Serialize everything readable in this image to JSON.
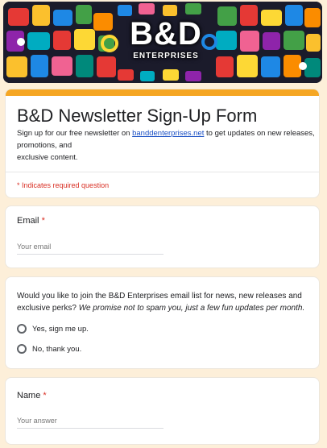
{
  "banner": {
    "brand_main": "B&D",
    "brand_sub": "ENTERPRISES"
  },
  "form": {
    "title": "B&D Newsletter Sign-Up Form",
    "description_before_link": "Sign up for our free newsletter on ",
    "description_link": "banddenterprises.net",
    "description_after_link": " to get updates on new releases, promotions, and",
    "description_line2": "exclusive content.",
    "required_note": "* Indicates required question",
    "accent_color": "#f5a623",
    "required_color": "#d93025",
    "link_color": "#1a4fc4"
  },
  "questions": {
    "email": {
      "label": "Email",
      "required_mark": "*",
      "placeholder": "Your email"
    },
    "optin": {
      "text_plain": "Would you like to join the B&D Enterprises email list for news, new releases and exclusive perks? ",
      "text_italic": "We promise not to spam you, just a few fun updates per month.",
      "options": [
        "Yes, sign me up.",
        "No, thank you."
      ]
    },
    "name": {
      "label": "Name",
      "required_mark": "*",
      "placeholder": "Your answer"
    }
  }
}
